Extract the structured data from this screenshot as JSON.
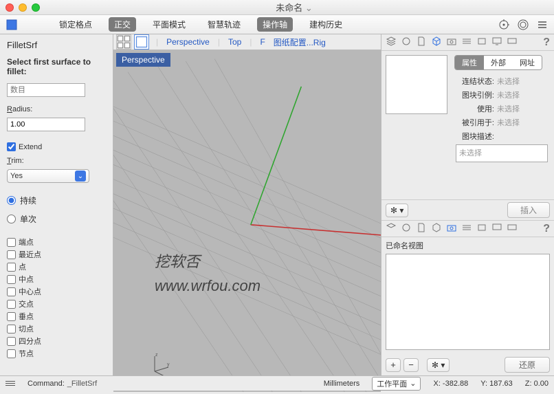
{
  "window": {
    "title": "未命名"
  },
  "toolbar": {
    "buttons": [
      "锁定格点",
      "正交",
      "平面模式",
      "智慧轨迹",
      "操作轴",
      "建构历史"
    ],
    "active": [
      1,
      4
    ]
  },
  "view_tabs": [
    "Perspective",
    "Top",
    "F",
    "图纸配置...Rig"
  ],
  "viewport": {
    "label": "Perspective"
  },
  "watermark": {
    "line1": "挖软否",
    "line2": "www.wrfou.com"
  },
  "left_panel": {
    "command": "FilletSrf",
    "prompt": "Select first surface to fillet:",
    "number_placeholder": "数目",
    "radius_label": "Radius:",
    "radius_value": "1.00",
    "extend_label": "Extend",
    "trim_label": "Trim:",
    "trim_value": "Yes",
    "radios": [
      "持续",
      "单次"
    ],
    "osnaps": [
      "端点",
      "最近点",
      "点",
      "中点",
      "中心点",
      "交点",
      "垂点",
      "切点",
      "四分点",
      "节点"
    ]
  },
  "right_panel": {
    "prop_tabs": [
      "属性",
      "外部",
      "网址"
    ],
    "props": [
      {
        "k": "连结状态:",
        "v": "未选择"
      },
      {
        "k": "图块引例:",
        "v": "未选择"
      },
      {
        "k": "使用:",
        "v": "未选择"
      },
      {
        "k": "被引用于:",
        "v": "未选择"
      },
      {
        "k": "图块描述:"
      }
    ],
    "desc_placeholder": "未选择",
    "insert_label": "插入",
    "named_views_label": "已命名视图",
    "restore_label": "还原"
  },
  "status": {
    "command_prefix": "Command:",
    "command": "_FilletSrf",
    "units": "Millimeters",
    "cplane": "工作平面",
    "x": "X: -382.88",
    "y": "Y: 187.63",
    "z": "Z: 0.00"
  }
}
